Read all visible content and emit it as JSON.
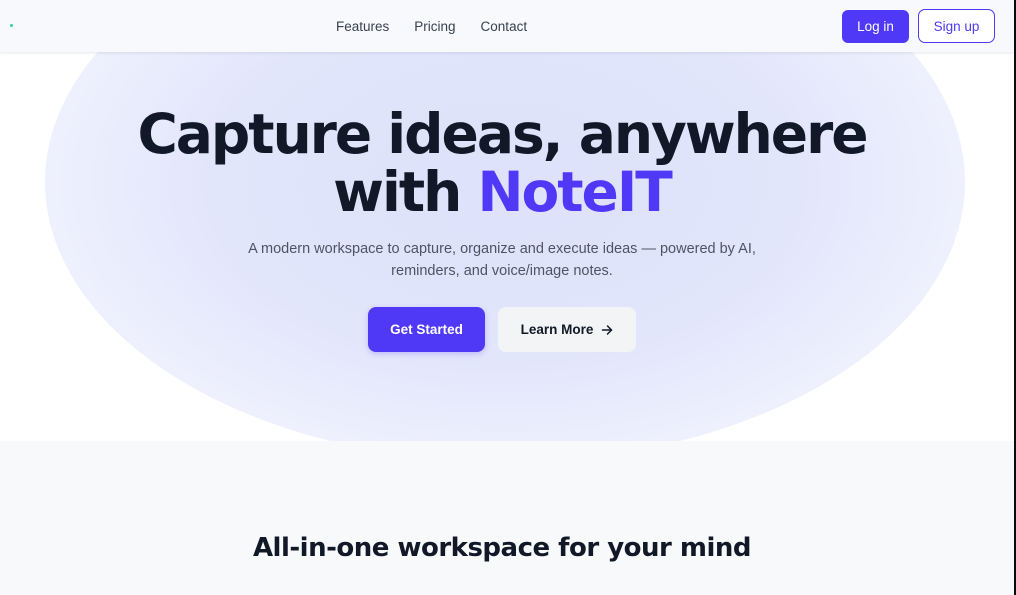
{
  "colors": {
    "accent": "#4f39f6",
    "logo_dot": "#34d399"
  },
  "navbar": {
    "logo_icon": "logo-dot-icon",
    "links": [
      "Features",
      "Pricing",
      "Contact"
    ],
    "login_label": "Log in",
    "signup_label": "Sign up"
  },
  "hero": {
    "title_line1": "Capture ideas, anywhere",
    "title_prefix": "with ",
    "title_brand": "NoteIT",
    "subtitle": "A modern workspace to capture, organize and execute ideas — powered by AI, reminders, and voice/image notes.",
    "primary_cta": "Get Started",
    "secondary_cta": "Learn More",
    "secondary_cta_icon": "arrow-right-icon"
  },
  "features": {
    "heading": "All-in-one workspace for your mind"
  }
}
